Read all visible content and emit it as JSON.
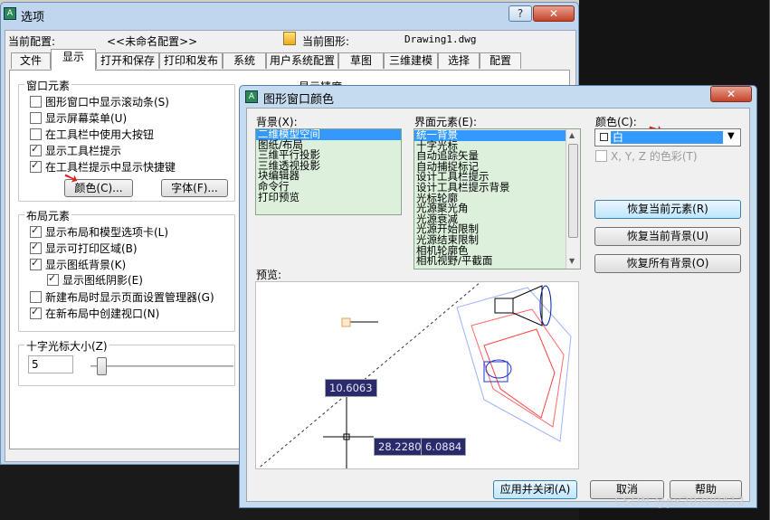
{
  "app": {
    "options_title": "选项",
    "current_profile_label": "当前配置:",
    "current_profile_value": "<<未命名配置>>",
    "current_drawing_label": "当前图形:",
    "current_drawing_value": "Drawing1.dwg"
  },
  "tabs": [
    "文件",
    "显示",
    "打开和保存",
    "打印和发布",
    "系统",
    "用户系统配置",
    "草图",
    "三维建模",
    "选择",
    "配置"
  ],
  "window_elements": {
    "title": "窗口元素",
    "items": [
      {
        "label": "图形窗口中显示滚动条(S)",
        "checked": false
      },
      {
        "label": "显示屏幕菜单(U)",
        "checked": false
      },
      {
        "label": "在工具栏中使用大按钮",
        "checked": false
      },
      {
        "label": "显示工具栏提示",
        "checked": true
      },
      {
        "label": "在工具栏提示中显示快捷键",
        "checked": true
      }
    ],
    "colors_button": "颜色(C)...",
    "fonts_button": "字体(F)..."
  },
  "layout_elements": {
    "title": "布局元素",
    "items": [
      {
        "label": "显示布局和模型选项卡(L)",
        "checked": true
      },
      {
        "label": "显示可打印区域(B)",
        "checked": true
      },
      {
        "label": "显示图纸背景(K)",
        "checked": true
      },
      {
        "label": "显示图纸阴影(E)",
        "checked": true
      },
      {
        "label": "新建布局时显示页面设置管理器(G)",
        "checked": false
      },
      {
        "label": "在新布局中创建视口(N)",
        "checked": true
      }
    ]
  },
  "crosshair": {
    "title": "十字光标大小(Z)",
    "value": "5",
    "slider_fraction": 0.05
  },
  "display_precision_partial": "显示精度",
  "color_dialog": {
    "title": "图形窗口颜色",
    "background_label": "背景(X):",
    "background_items": [
      "二维模型空间",
      "图纸/布局",
      "三维平行投影",
      "三维透视投影",
      "块编辑器",
      "命令行",
      "打印预览"
    ],
    "background_selected": 0,
    "interface_label": "界面元素(E):",
    "interface_items": [
      "统一背景",
      "十字光标",
      "自动追踪矢量",
      "自动捕捉标记",
      "设计工具栏提示",
      "设计工具栏提示背景",
      "光标轮廓",
      "光源聚光角",
      "光源衰减",
      "光源开始限制",
      "光源结束限制",
      "相机轮廓色",
      "相机视野/平截面"
    ],
    "interface_selected": 0,
    "color_label": "颜色(C):",
    "color_value": "白",
    "tint_label": "X, Y, Z 的色彩(T)",
    "restore_element": "恢复当前元素(R)",
    "restore_context": "恢复当前背景(U)",
    "restore_all": "恢复所有背景(O)",
    "preview_label": "预览:",
    "preview_tips": [
      "10.6063",
      "28.2280",
      "6.0884"
    ],
    "apply_close": "应用并关闭(A)",
    "cancel": "取消",
    "help": "帮助"
  },
  "watermark": "CSDN @px20200412",
  "colors": {
    "accent": "#3399ff",
    "list_bg": "#dcf0dc",
    "close_btn": "#c5432a",
    "arrow": "#e0201a"
  }
}
